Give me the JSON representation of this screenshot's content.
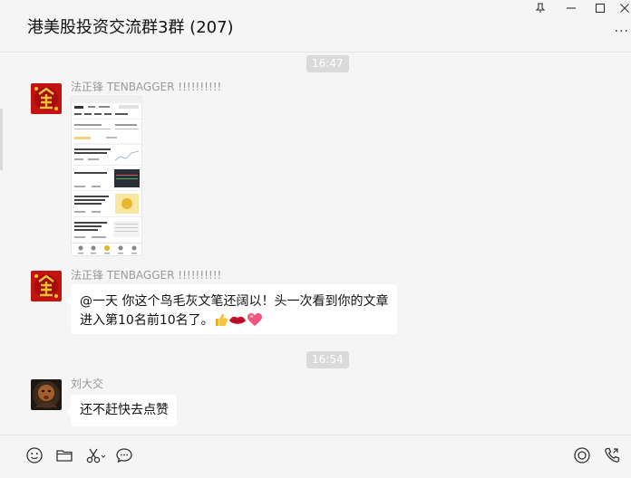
{
  "header": {
    "title": "港美股投资交流群3群 (207)",
    "more_label": "..."
  },
  "messages": [
    {
      "type": "time",
      "text": "16:47"
    },
    {
      "type": "image",
      "sender": "法正锋  TENBAGGER !!!!!!!!!!",
      "avatar": "gold-character-avatar"
    },
    {
      "type": "text",
      "sender": "法正锋  TENBAGGER !!!!!!!!!!",
      "avatar": "gold-character-avatar",
      "line1": "@一天 你这个鸟毛灰文笔还阔以！头一次看到你的文章",
      "line2": "进入第10名前10名了。",
      "emojis": [
        "thumbs-up-emoji",
        "lips-emoji",
        "heart-emoji"
      ]
    },
    {
      "type": "time",
      "text": "16:54"
    },
    {
      "type": "text",
      "sender": "刘大交",
      "avatar": "dark-portrait-avatar",
      "line1": "还不赶快去点赞"
    }
  ],
  "toolbar": {
    "icons": [
      "emoji-icon",
      "folder-icon",
      "scissors-icon",
      "chat-bubble-icon",
      "voice-icon",
      "video-call-icon"
    ]
  },
  "colors": {
    "background": "#f5f5f5",
    "bubble": "#ffffff",
    "time_pill": "#dadada",
    "sender_text": "#999999"
  }
}
